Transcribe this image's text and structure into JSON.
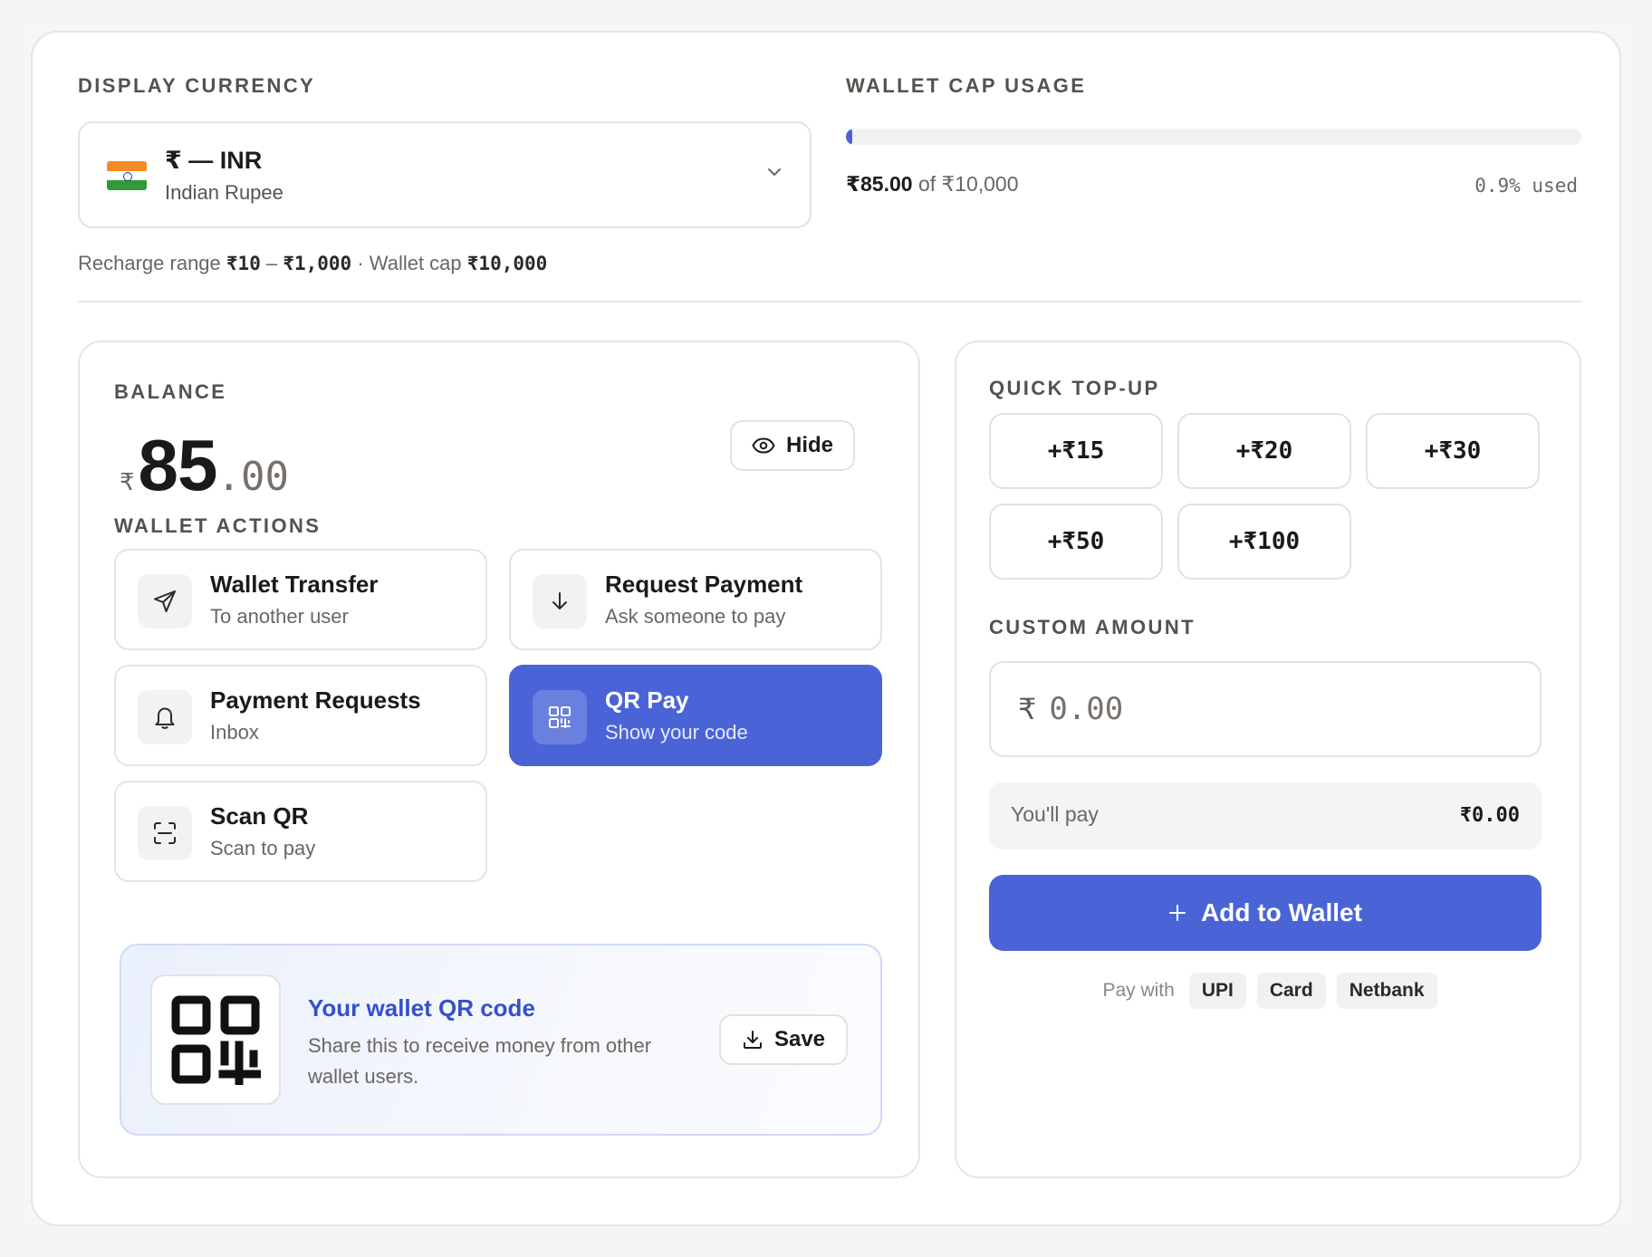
{
  "display_currency": {
    "label": "DISPLAY CURRENCY",
    "selected_code": "₹ — INR",
    "selected_name": "Indian Rupee",
    "flag": "india-flag"
  },
  "range_note": {
    "prefix": "Recharge range",
    "min": "₹10",
    "dash": "–",
    "max": "₹1,000",
    "sep": "· Wallet cap",
    "cap": "₹10,000"
  },
  "wallet_cap": {
    "label": "WALLET CAP USAGE",
    "used_amount": "₹85.00",
    "of_text": "of ₹10,000",
    "used_percent_text": "0.9% used",
    "used_fraction": 0.009
  },
  "balance": {
    "label": "BALANCE",
    "symbol": "₹",
    "integer": "85",
    "decimal": ".00",
    "hide_label": "Hide"
  },
  "wallet_actions": {
    "label": "WALLET ACTIONS",
    "items": [
      {
        "title": "Wallet Transfer",
        "subtitle": "To another user",
        "icon": "send-icon"
      },
      {
        "title": "Request Payment",
        "subtitle": "Ask someone to pay",
        "icon": "arrow-down-icon"
      },
      {
        "title": "Payment Requests",
        "subtitle": "Inbox",
        "icon": "bell-icon"
      },
      {
        "title": "QR Pay",
        "subtitle": "Show your code",
        "icon": "qr-icon"
      },
      {
        "title": "Scan QR",
        "subtitle": "Scan to pay",
        "icon": "scan-icon"
      }
    ]
  },
  "qr_card": {
    "title": "Your wallet QR code",
    "description": "Share this to receive money from other wallet users.",
    "save_label": "Save"
  },
  "quick_topup": {
    "label": "QUICK TOP-UP",
    "amounts": [
      "+₹15",
      "+₹20",
      "+₹30",
      "+₹50",
      "+₹100"
    ]
  },
  "custom_amount": {
    "label": "CUSTOM AMOUNT",
    "symbol": "₹",
    "placeholder": "0.00"
  },
  "summary": {
    "label": "You'll pay",
    "value": "₹0.00"
  },
  "add_button": {
    "label": "Add to Wallet"
  },
  "pay_with": {
    "label": "Pay with",
    "methods": [
      "UPI",
      "Card",
      "Netbank"
    ]
  },
  "colors": {
    "accent": "#4a64d8",
    "accent_text": "#3550c9"
  }
}
